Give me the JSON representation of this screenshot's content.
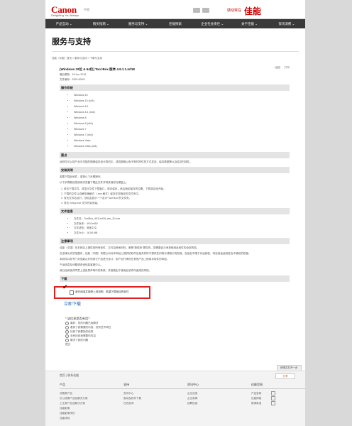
{
  "header": {
    "logo": "Canon",
    "region": "中国",
    "tagline": "Delighting You Always",
    "brand_small": "感动常在",
    "brand_big": "佳能"
  },
  "nav": [
    "产品互动 ⌄",
    "购买指南 ⌄",
    "服务与支持 ⌄",
    "佳能探索",
    "企业社会责任 ⌄",
    "关于佳能 ⌄",
    "资讯消费 ⌄"
  ],
  "page_title": "服务与支持",
  "breadcrumb": "佳能（中国）首页 > 服务与支持 > 下载与支持",
  "tools": {
    "back": "‹ 返回",
    "print": "打印"
  },
  "doc": {
    "title": "[Windows 32位 & 64位] Tool Box 版本 4.9.1.1.mf18",
    "date": "最后更新：15-Jun-2015",
    "code": "文件编号：3200-00001"
  },
  "os_section": {
    "heading": "操作系统",
    "items": [
      "Windows 10",
      "Windows 10 (x64)",
      "Windows 8.1",
      "Windows 8.1 (x64)",
      "Windows 8",
      "Windows 8 (x64)",
      "Windows 7",
      "Windows 7 (x64)",
      "Windows Vista",
      "Windows Vista (x64)"
    ]
  },
  "summary_section": {
    "heading": "要点",
    "text": "此软件可以将产品中扫描的图像保存到计算机中，或将图像以电子邮件附件的方式发送，保存数据等以及发送扫描件。"
  },
  "install_section": {
    "heading": "安装说明",
    "intro": "若要下载此软件，请按以下步骤操作。",
    "intro2": "以下步骤假设您使用浏览器下载此文件并将其保存在硬盘上。",
    "steps": [
      "1. 单击下载文件，将显示文件下载窗口，单击保存，然后指定保存的位置，下载将自动开始。",
      "2. 下载的文件以自解压缩格式（.exe 格式）保存在您指定的文件夹中。",
      "3. 双击文件名运行，然后会显示一个名为“Tool Box”的文件夹。",
      "4. 双击 Setup.exe 文件开始安装。"
    ]
  },
  "file_section": {
    "heading": "文件信息",
    "items": [
      "文件名：ToolBox_4911mf18_win_Zh.exe",
      "文件版本：4911mf18",
      "文件语言：简体中文",
      "文件大小：18.54 MB"
    ]
  },
  "notice_section": {
    "heading": "注意事项",
    "p1": "佳能（中国）在本网站上提供的所有软件、文件及其他材料，都是“按现状”提供的，您需要自己承担使用此软件的全部风险。",
    "p2": "在法律允许的范围内，佳能（中国）有限公司对本网站上提供的软件及相关材料不提供任何明示或默示的担保，包括但不限于对适销性、特定用途适用性及不侵权的担保。",
    "p3": "本软件并非专门对佳能以外的其它产品进行设计，用户自行承担在其他产品上使用本软件的风险。",
    "p4": "产品信息及问题请咨询佳能客服中心。",
    "p5": "我已经阅读并同意上述免责声明中的条款，并接受由于使用此软件所造成的风险。"
  },
  "download": {
    "heading": "下载",
    "agree_text": "我已阅读并接受上述说明，希望下载相应的软件",
    "button": "立即下载"
  },
  "survey": {
    "question": "* 该信息是否有用？",
    "options": [
      "最好，您的问题已经解决",
      "看到了我需要的内容，但有些不明白",
      "找到了我要找的信息",
      "没有找到我需要的内容",
      "解决了我的问题"
    ],
    "submit": "提交"
  },
  "next_page": "获得并打开一步",
  "footer": {
    "links": "首页  |  联系佳能",
    "share": "分享",
    "columns": [
      {
        "head": "产品",
        "items": [
          "消费类产品",
          "办公成像产品及解决方案",
          "工业类产品及解决方案",
          "佳能影像",
          "佳能影像学校",
          "佳能体验"
        ]
      },
      {
        "head": "支持",
        "items": [
          "资讯中心",
          "驱动及软件下载",
          "在线咨询"
        ]
      },
      {
        "head": "资讯中心",
        "items": [
          "企业信息",
          "企业新闻",
          "招聘信息"
        ]
      },
      {
        "head": "佳能官网",
        "items": [
          "产品官网",
          "佳能博客",
          "微博新浪"
        ]
      }
    ]
  }
}
